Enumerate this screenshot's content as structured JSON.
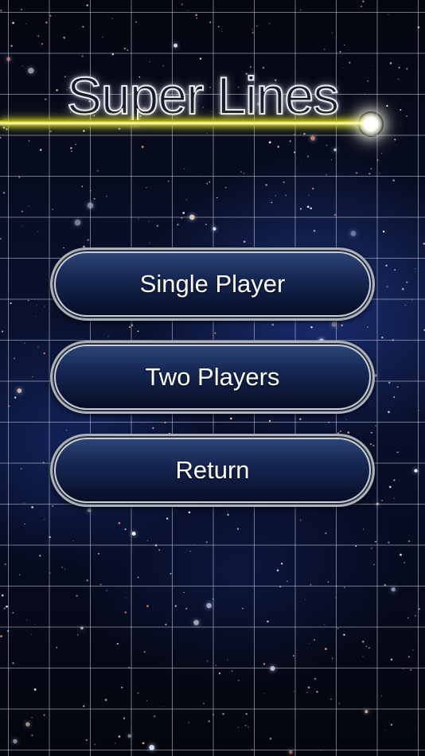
{
  "game": {
    "title": "Super Lines"
  },
  "menu": {
    "single_player_label": "Single Player",
    "two_players_label": "Two Players",
    "return_label": "Return"
  },
  "colors": {
    "laser_line": "#ffff40",
    "button_fill": "#0c1a3e",
    "button_border": "#aab0bc",
    "grid_line": "#c8cddc",
    "sky": "#050814"
  }
}
